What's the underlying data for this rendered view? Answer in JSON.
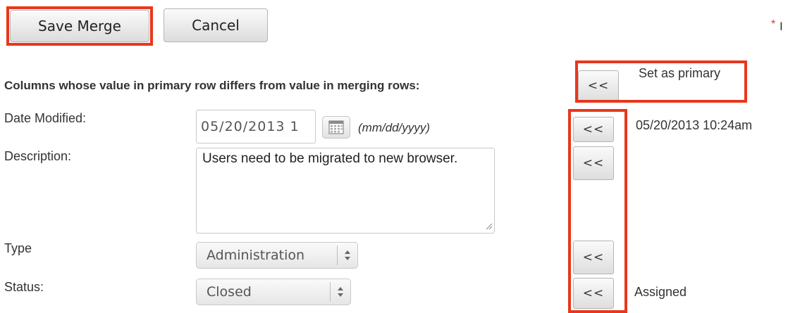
{
  "toolbar": {
    "save_label": "Save Merge",
    "cancel_label": "Cancel",
    "required_marker": "*",
    "required_partial": "I"
  },
  "section": {
    "heading": "Columns whose value in primary row differs from value in merging rows:",
    "set_primary_button": "<<",
    "set_primary_label": "Set as primary"
  },
  "fields": {
    "date_modified": {
      "label": "Date Modified:",
      "value": "05/20/2013 1",
      "format_hint": "(mm/dd/yyyy)",
      "copy_button": "<<",
      "merge_value": "05/20/2013 10:24am"
    },
    "description": {
      "label": "Description:",
      "value": "Users need to be migrated to new browser.",
      "copy_button": "<<"
    },
    "type": {
      "label": "Type",
      "value": "Administration",
      "copy_button": "<<"
    },
    "status": {
      "label": "Status:",
      "value": "Closed",
      "copy_button": "<<",
      "merge_value": "Assigned"
    }
  },
  "colors": {
    "highlight": "#e8371c",
    "required": "#e8371c"
  }
}
